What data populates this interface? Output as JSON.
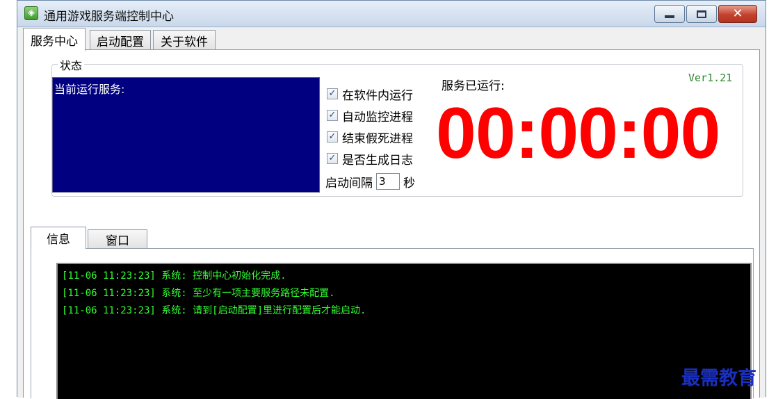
{
  "window": {
    "title": "通用游戏服务端控制中心",
    "app_icon": "game-app-icon",
    "controls": {
      "minimize": "minimize-icon",
      "maximize": "maximize-icon",
      "close": "close-icon"
    }
  },
  "tabs": [
    {
      "label": "服务中心",
      "active": true
    },
    {
      "label": "启动配置",
      "active": false
    },
    {
      "label": "关于软件",
      "active": false
    }
  ],
  "status": {
    "legend": "状态",
    "services_label": "当前运行服务:",
    "options": [
      {
        "label": "在软件内运行",
        "checked": true
      },
      {
        "label": "自动监控进程",
        "checked": true
      },
      {
        "label": "结束假死进程",
        "checked": true
      },
      {
        "label": "是否生成日志",
        "checked": true
      }
    ],
    "interval_label": "启动间隔",
    "interval_value": "3",
    "interval_unit": "秒",
    "running_label": "服务已运行:",
    "version": "Ver1.21",
    "timer": "00:00:00"
  },
  "lower_tabs": [
    {
      "label": "信息",
      "active": true
    },
    {
      "label": "窗口",
      "active": false
    }
  ],
  "log": [
    "[11-06 11:23:23] 系统: 控制中心初始化完成.",
    "[11-06 11:23:23] 系统: 至少有一项主要服务路径未配置.",
    "[11-06 11:23:23] 系统: 请到[启动配置]里进行配置后才能启动."
  ],
  "watermark": "最需教育",
  "colors": {
    "timer": "#ff0000",
    "log_text": "#33ff33",
    "services_bg": "#000080",
    "version": "#2e8b2e",
    "watermark": "#1a2fbf"
  }
}
